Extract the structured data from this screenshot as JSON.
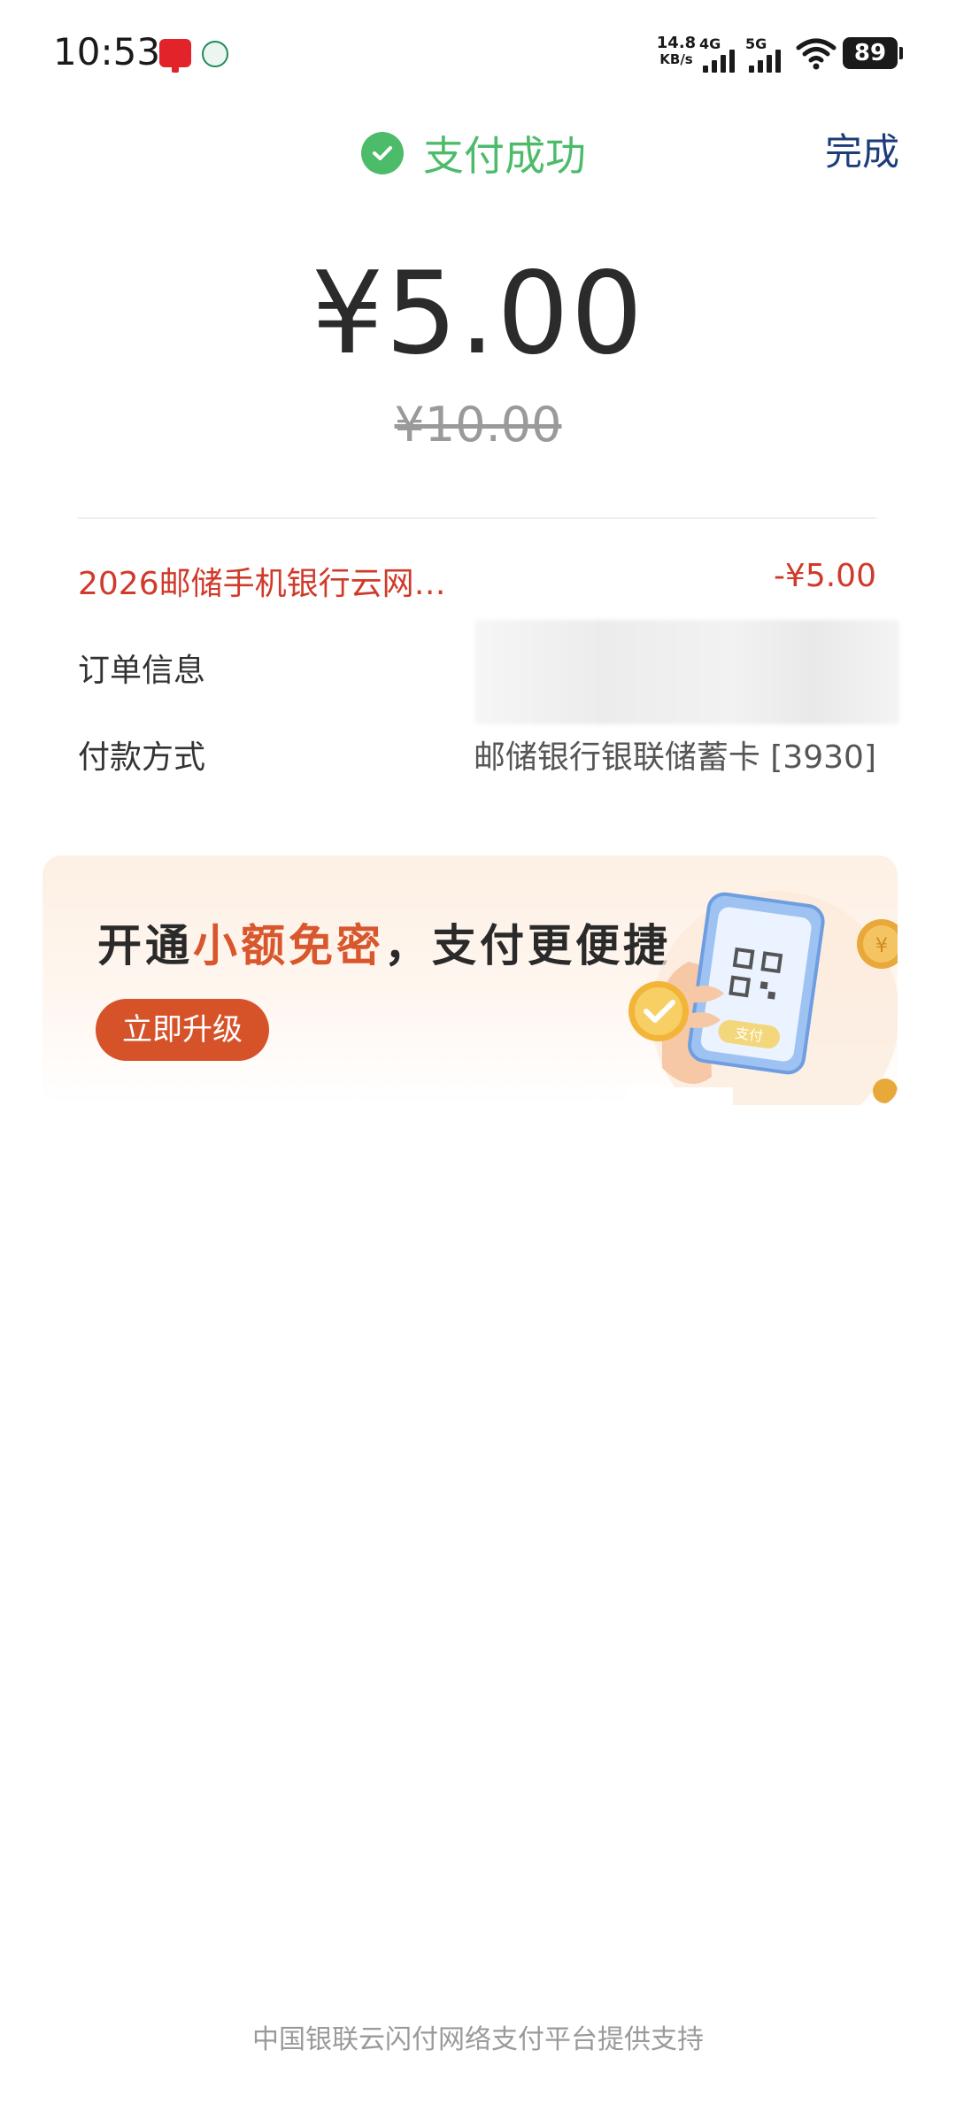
{
  "status_bar": {
    "time": "10:53",
    "net_speed_value": "14.8",
    "net_speed_unit": "KB/s",
    "signal_1_label": "4G",
    "signal_2_label": "5G",
    "battery": "89"
  },
  "header": {
    "title": "支付成功",
    "done_label": "完成"
  },
  "payment": {
    "amount": "¥5.00",
    "original_amount": "¥10.00"
  },
  "details": {
    "discount_label": "2026邮储手机银行云网…",
    "discount_value": "-¥5.00",
    "order_label": "订单信息",
    "order_value": "",
    "method_label": "付款方式",
    "method_value": "邮储银行银联储蓄卡 [3930]"
  },
  "promo": {
    "title_prefix": "开通",
    "title_highlight": "小额免密",
    "title_suffix": "，支付更便捷",
    "button_label": "立即升级",
    "phone_button_label": "支付"
  },
  "footer": {
    "text": "中国银联云闪付网络支付平台提供支持"
  },
  "colors": {
    "success": "#4cbb6a",
    "done": "#1c3d7a",
    "discount": "#d03a2a",
    "promo_accent": "#d6532a"
  }
}
